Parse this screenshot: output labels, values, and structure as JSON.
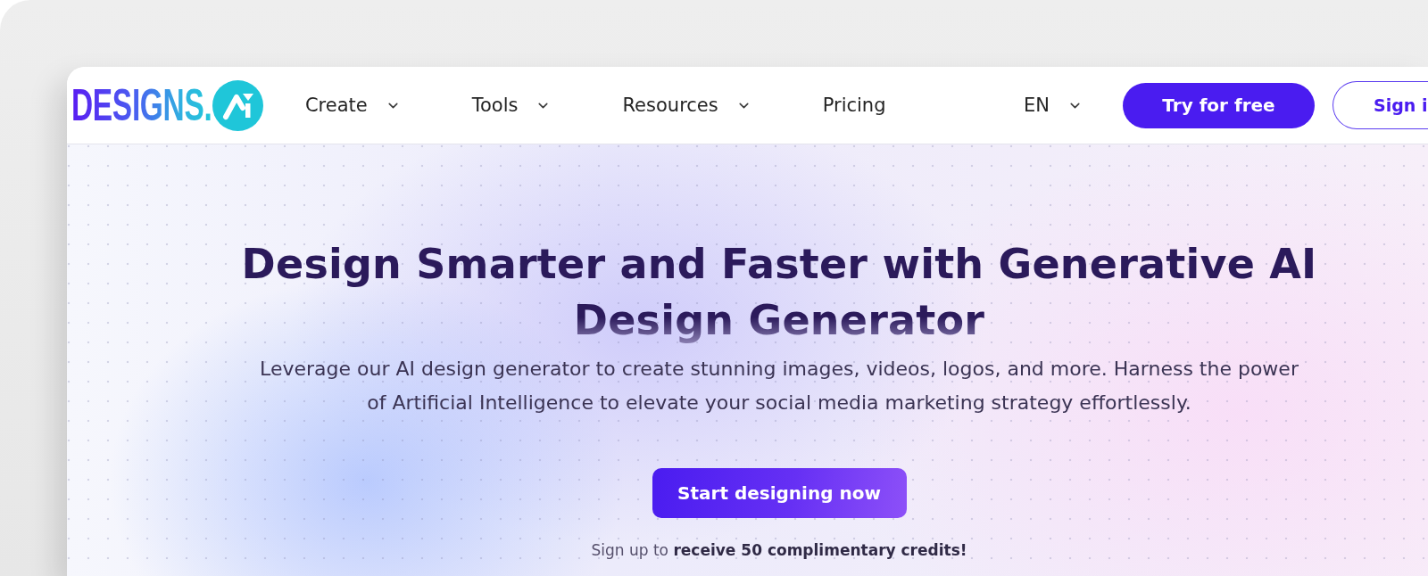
{
  "logo": {
    "text": "DESIGNS."
  },
  "nav": {
    "items": [
      {
        "label": "Create",
        "dropdown": true
      },
      {
        "label": "Tools",
        "dropdown": true
      },
      {
        "label": "Resources",
        "dropdown": true
      },
      {
        "label": "Pricing",
        "dropdown": false
      }
    ]
  },
  "language": {
    "label": "EN",
    "dropdown": true
  },
  "buttons": [
    {
      "kind": "primary",
      "label": "Try for free"
    },
    {
      "kind": "outline",
      "label": "Sign i"
    }
  ],
  "hero": {
    "title": "Design Smarter and Faster with Generative AI Design Generator",
    "subtitle": "Leverage our AI design generator to create stunning images, videos, logos, and more. Harness the power of Artificial Intelligence to elevate your social media marketing strategy effortlessly.",
    "cta": "Start designing now",
    "note": "Sign up to **receive 50 complimentary credits!**"
  }
}
